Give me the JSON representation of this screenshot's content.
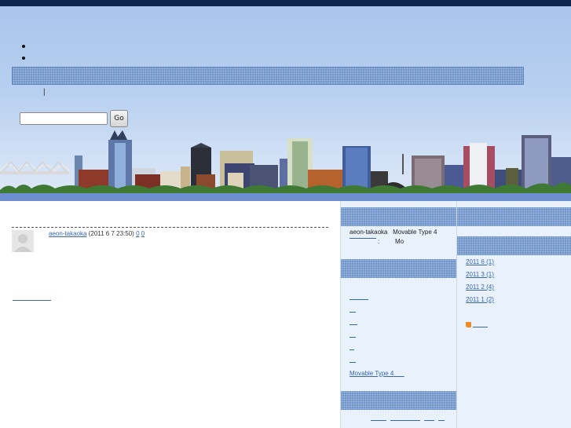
{
  "sidebar_mid": {
    "author_text": "aeon-takaoka",
    "engine_text": "Movable Type 4",
    "colon_text": ":",
    "mo_text": "Mo",
    "footer_link": "Movable Type 4"
  },
  "post": {
    "author": "aeon-takaoka",
    "date": "(2011 6  7  23:50)",
    "comments": "0",
    "trackbacks": "0"
  },
  "header": {
    "search_button": "Go",
    "search_value": "",
    "separator": "|"
  },
  "archives": [
    "2011 6  (1)",
    "2011 3  (1)",
    "2011 2  (4)",
    "2011 1  (2)"
  ],
  "colors": {
    "accent": "#6f94c8",
    "topbar": "#0e2550",
    "link": "#3866b3"
  },
  "icons": [
    "rss-icon",
    "avatar-icon",
    "skyline-image"
  ]
}
